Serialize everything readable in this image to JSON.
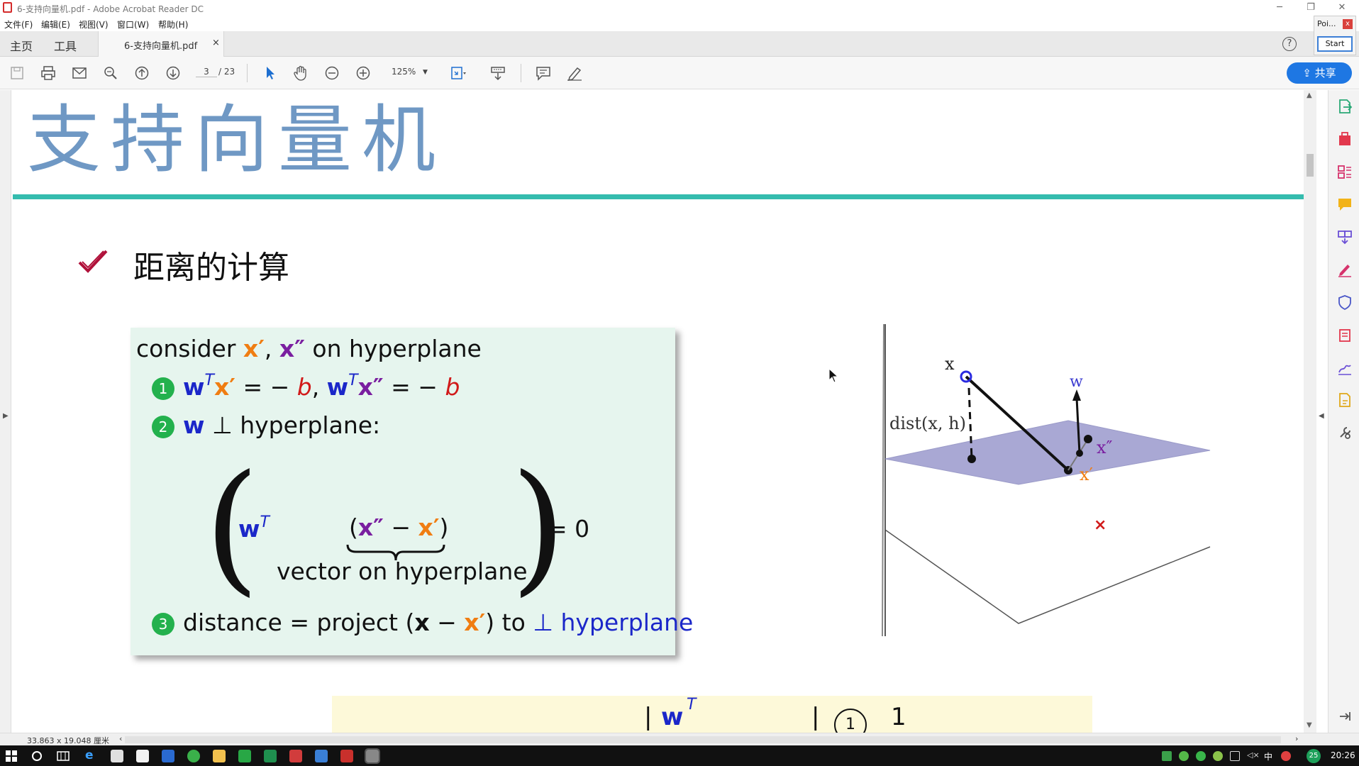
{
  "window": {
    "title": "6-支持向量机.pdf - Adobe Acrobat Reader DC",
    "minimize": "─",
    "restore": "❐",
    "close": "✕"
  },
  "menu": [
    "文件(F)",
    "编辑(E)",
    "视图(V)",
    "窗口(W)",
    "帮助(H)"
  ],
  "mini_panel": {
    "label": "Poi...",
    "close": "x",
    "start": "Start"
  },
  "tabs": {
    "home": "主页",
    "tools": "工具",
    "document": "6-支持向量机.pdf",
    "close": "×",
    "help": "?"
  },
  "toolbar": {
    "page_current": "3",
    "page_total": "/ 23",
    "zoom": "125%",
    "share": "共享"
  },
  "slide": {
    "title": "支持向量机",
    "section": "距离的计算",
    "formula": {
      "line1": {
        "a": "consider ",
        "xp": "x′",
        "comma": ", ",
        "xpp": "x″",
        "rest": " on hyperplane"
      },
      "line2": {
        "num": "1",
        "w1": "w",
        "t1": "T",
        "x1": "x′",
        "eq1": " = − ",
        "b1": "b",
        "sep": ", ",
        "w2": "w",
        "t2": "T",
        "x2": "x″",
        "eq2": " = − ",
        "b2": "b"
      },
      "line3": {
        "num": "2",
        "w": "w",
        "rest": " ⊥ hyperplane:"
      },
      "matrix": {
        "w": "w",
        "t": "T",
        "lp": "(",
        "xpp": "x″",
        "minus": " − ",
        "xp": "x′",
        "rp": ")",
        "brace": "⏟",
        "eq": "= 0",
        "under": "vector on hyperplane"
      },
      "line4": {
        "num": "3",
        "a": "distance = project (",
        "x": "x",
        "minus": " − ",
        "xp": "x′",
        "b": ") to ",
        "perp": "⊥ hyperplane"
      }
    },
    "yellow_box": {
      "bar": "|",
      "w": "w",
      "t": "T",
      "bar2": "|",
      "num": "1",
      "one": "1"
    },
    "diagram": {
      "x_label": "x",
      "w_label": "w",
      "dist_label": "dist(x, h)",
      "xpp_label": "x″",
      "xp_label": "x′",
      "cross": "×"
    }
  },
  "status": {
    "dimensions": "33.863 x 19.048 厘米"
  },
  "taskbar": {
    "clock": "20:26",
    "badge": "25",
    "ime": "中"
  },
  "colors": {
    "title_blue": "#6f98c4",
    "teal_rule": "#35bcae",
    "box_green": "#e6f5ee",
    "num_green": "#23b14d",
    "vector_blue": "#1b27c9",
    "prime_orange": "#f07d12",
    "dprime_purple": "#7a1fa0",
    "b_red": "#d11a1a",
    "plane_lavender": "#a9a8d4",
    "share_blue": "#1e77e3"
  }
}
